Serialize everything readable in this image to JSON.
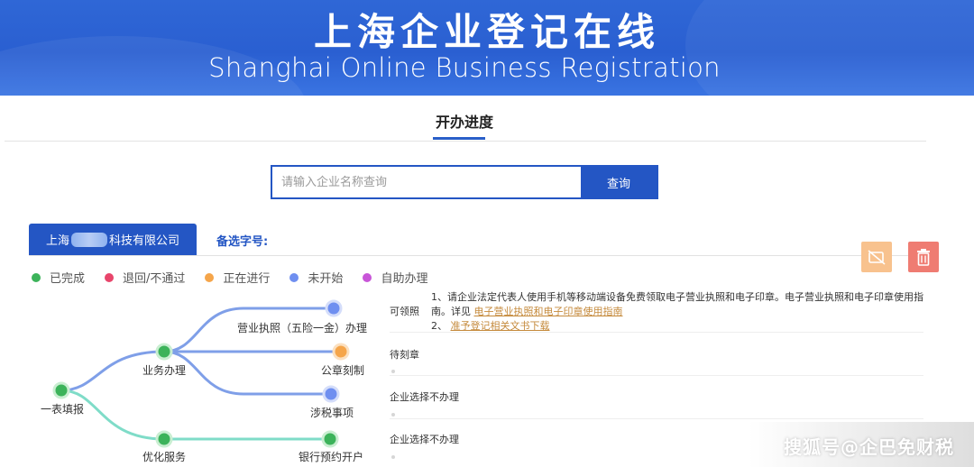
{
  "banner": {
    "title": "上海企业登记在线",
    "subtitle": "Shanghai Online Business Registration"
  },
  "page": {
    "title": "开办进度"
  },
  "search": {
    "placeholder": "请输入企业名称查询",
    "button_label": "查询"
  },
  "company_tab": {
    "prefix": "上海",
    "suffix": "科技有限公司"
  },
  "alt_name_label": "备选字号:",
  "actions": {
    "cancel_icon": "no-camera-icon",
    "delete_icon": "trash-icon",
    "cancel_color": "#f8c28e",
    "delete_color": "#ef7c72"
  },
  "legend": [
    {
      "label": "已完成",
      "color": "#3cb35a"
    },
    {
      "label": "退回/不通过",
      "color": "#e8456b"
    },
    {
      "label": "正在进行",
      "color": "#f5a54a"
    },
    {
      "label": "未开始",
      "color": "#6f8ff0"
    },
    {
      "label": "自助办理",
      "color": "#c855d8"
    }
  ],
  "flow": {
    "root": "一表填报",
    "business": "业务办理",
    "optimize": "优化服务",
    "license": "营业执照（五险一金）办理",
    "seal": "公章刻制",
    "tax": "涉税事项",
    "bank": "银行预约开户"
  },
  "status": {
    "license_status": "可领照",
    "license_detail_1": "1、请企业法定代表人使用手机等移动端设备免费领取电子营业执照和电子印章。电子营业执照和电子印章使用指南。详见",
    "license_link_1": "电子营业执照和电子印章使用指南",
    "license_detail_2_prefix": "2、",
    "license_link_2": "准予登记相关文书下载",
    "seal_status": "待刻章",
    "tax_status": "企业选择不办理",
    "bank_status": "企业选择不办理"
  },
  "watermark": "搜狐号@企巴免财税"
}
